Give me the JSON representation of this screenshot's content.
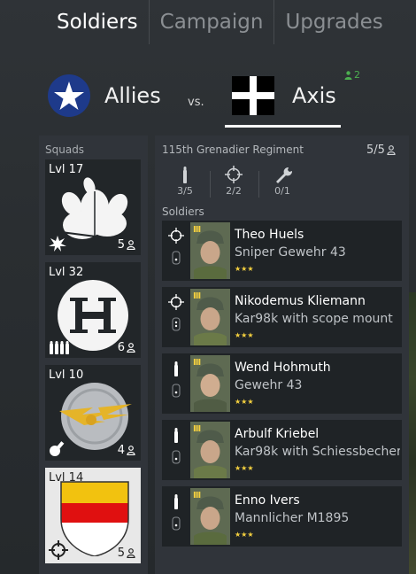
{
  "tabs": [
    {
      "label": "Soldiers",
      "active": true
    },
    {
      "label": "Campaign",
      "active": false
    },
    {
      "label": "Upgrades",
      "active": false
    }
  ],
  "factions": {
    "allies": "Allies",
    "vs": "vs.",
    "axis": "Axis",
    "axis_online_count": "2"
  },
  "squads": {
    "title": "Squads",
    "items": [
      {
        "level": "Lvl 17",
        "count": "5",
        "emblem": "oak-leaves-emblem",
        "type_icon": "explosion-icon",
        "selected": false
      },
      {
        "level": "Lvl 32",
        "count": "6",
        "emblem": "h-circle-emblem",
        "type_icon": "ammo-icon",
        "selected": false
      },
      {
        "level": "Lvl 10",
        "count": "4",
        "emblem": "eagle-wings-emblem",
        "type_icon": "grenade-icon",
        "selected": false
      },
      {
        "level": "Lvl 14",
        "count": "5",
        "emblem": "striped-shield-emblem",
        "type_icon": "crosshair-icon",
        "selected": true
      }
    ]
  },
  "regiment": {
    "name": "115th Grenadier Regiment",
    "count": "5/5",
    "slots": [
      {
        "icon": "rifle-ammo-icon",
        "value": "3/5"
      },
      {
        "icon": "crosshair-icon",
        "value": "2/2"
      },
      {
        "icon": "wrench-icon",
        "value": "0/1"
      }
    ],
    "soldiers_title": "Soldiers"
  },
  "soldiers": [
    {
      "name": "Theo Huels",
      "weapon": "Sniper Gewehr 43",
      "rank": "III",
      "stars": "★★★",
      "class_icon": "crosshair-icon"
    },
    {
      "name": "Nikodemus Kliemann",
      "weapon": "Kar98k with scope mount",
      "rank": "III",
      "stars": "★★★",
      "class_icon": "crosshair-icon"
    },
    {
      "name": "Wend Hohmuth",
      "weapon": "Gewehr 43",
      "rank": "III",
      "stars": "★★★",
      "class_icon": "rifle-ammo-icon"
    },
    {
      "name": "Arbulf Kriebel",
      "weapon": "Kar98k with Schiessbecher",
      "rank": "III",
      "stars": "★★★",
      "class_icon": "rifle-ammo-icon"
    },
    {
      "name": "Enno Ivers",
      "weapon": "Mannlicher M1895",
      "rank": "III",
      "stars": "★★★",
      "class_icon": "rifle-ammo-icon"
    }
  ]
}
